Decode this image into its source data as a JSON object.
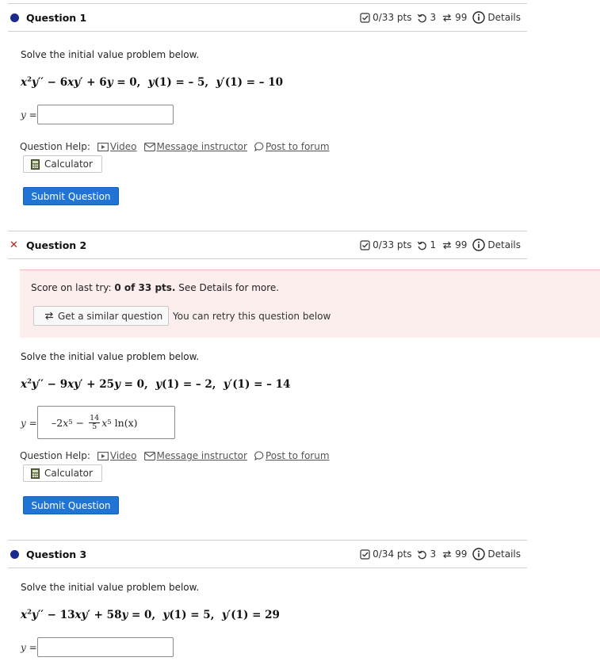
{
  "questions": [
    {
      "title": "Question 1",
      "status": "unanswered",
      "pts": "0/33 pts",
      "attempts": "3",
      "versions": "99",
      "details": "Details",
      "prompt": "Solve the initial value problem below.",
      "equation": {
        "c1": "6",
        "c2": "6",
        "y1": "– 5",
        "yp1": "– 10"
      },
      "answer_label": "y =",
      "answer_value": ""
    },
    {
      "title": "Question 2",
      "status": "incorrect",
      "pts": "0/33 pts",
      "attempts": "1",
      "versions": "99",
      "details": "Details",
      "prompt": "Solve the initial value problem below.",
      "equation": {
        "c1": "9",
        "c2": "25",
        "y1": "– 2",
        "yp1": "– 14"
      },
      "answer_label": "y =",
      "answer_value": {
        "term1_coef": "–2",
        "term2_num": "14",
        "term2_den": "5",
        "ln_text": "ln(x)"
      }
    },
    {
      "title": "Question 3",
      "status": "unanswered",
      "pts": "0/34 pts",
      "attempts": "3",
      "versions": "99",
      "details": "Details",
      "prompt": "Solve the initial value problem below.",
      "equation": {
        "c1": "13",
        "c2": "58",
        "y1": "5",
        "yp1": "29"
      },
      "answer_label": "y =",
      "answer_value": ""
    }
  ],
  "help": {
    "label": "Question Help:",
    "video": "Video",
    "message": "Message instructor",
    "forum": "Post to forum",
    "calculator": "Calculator"
  },
  "submit_label": "Submit Question",
  "feedback": {
    "score_prefix": "Score on last try:",
    "score_value": "0 of 33 pts.",
    "score_suffix": "See Details for more.",
    "similar_label": "Get a similar question",
    "retry_text": "You can retry this question below"
  },
  "colors": {
    "accent": "#1f74d4",
    "dot": "#1a2a8f",
    "error": "#b3261e",
    "feedback_bg": "#fdeeee"
  }
}
